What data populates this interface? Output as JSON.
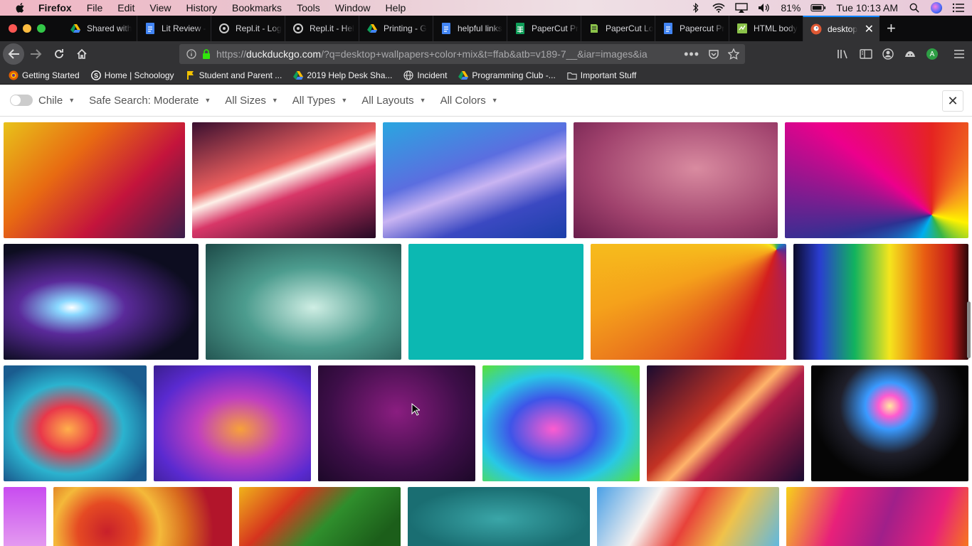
{
  "menubar": {
    "app": "Firefox",
    "items": [
      "File",
      "Edit",
      "View",
      "History",
      "Bookmarks",
      "Tools",
      "Window",
      "Help"
    ],
    "battery": "81%",
    "clock": "Tue 10:13 AM"
  },
  "tabs": [
    {
      "label": "Shared with",
      "icon": "google-drive-icon"
    },
    {
      "label": "Lit Review -",
      "icon": "google-docs-icon"
    },
    {
      "label": "Repl.it - Log",
      "icon": "replit-icon"
    },
    {
      "label": "Repl.it - Hel",
      "icon": "replit-icon"
    },
    {
      "label": "Printing - G",
      "icon": "google-drive-icon"
    },
    {
      "label": "helpful links",
      "icon": "google-docs-icon"
    },
    {
      "label": "PaperCut Pr",
      "icon": "google-sheets-icon"
    },
    {
      "label": "PaperCut Lo",
      "icon": "papercut-icon"
    },
    {
      "label": "Papercut Pr",
      "icon": "google-docs-icon"
    },
    {
      "label": "HTML body",
      "icon": "google-sheets-icon"
    },
    {
      "label": "desktop",
      "icon": "duckduckgo-icon",
      "active": true
    }
  ],
  "address": {
    "prefix": "https://",
    "host": "duckduckgo.com",
    "path": "/?q=desktop+wallpapers+color+mix&t=ffab&atb=v189-7__&iar=images&ia"
  },
  "bookmarks": [
    {
      "label": "Getting Started",
      "icon": "firefox-icon"
    },
    {
      "label": "Home | Schoology",
      "icon": "schoology-icon"
    },
    {
      "label": "Student and Parent ...",
      "icon": "bookmark-flag-icon"
    },
    {
      "label": "2019 Help Desk Sha...",
      "icon": "google-drive-icon"
    },
    {
      "label": "Incident",
      "icon": "globe-icon"
    },
    {
      "label": "Programming Club -...",
      "icon": "google-drive-icon"
    },
    {
      "label": "Important Stuff",
      "icon": "folder-icon"
    }
  ],
  "filters": {
    "region": "Chile",
    "safe_search": "Safe Search: Moderate",
    "sizes": "All Sizes",
    "types": "All Types",
    "layouts": "All Layouts",
    "colors": "All Colors"
  },
  "colors": {
    "tab_strip": "#0c0c0d",
    "toolbar": "#323234",
    "active_tab_accent": "#0a84ff",
    "results_bg": "#ffffff"
  },
  "image_results": [
    {
      "name": "image-mosaic-squares",
      "bg": "linear-gradient(135deg,#e8c21a,#e86a12 35%,#c4143c 65%,#3a1f4a)"
    },
    {
      "name": "image-light-streak-pink",
      "bg": "linear-gradient(160deg,#3a1030,#e95d5d 40%,#fdf0e8 48%,#d83768 60%,#250a24)"
    },
    {
      "name": "image-blue-waves",
      "bg": "linear-gradient(160deg,#2aa6e0,#5b6ee0 40%,#c9b4f2 55%,#3b49c2 75%,#1b3fa8)"
    },
    {
      "name": "image-mauve-gradient",
      "bg": "radial-gradient(ellipse at 60% 40%,#d98ba0,#a0426d 60%,#6a1d4b)"
    },
    {
      "name": "image-rainbow-swirl",
      "bg": "conic-gradient(from 0deg at 80% 80%,#e52421,#f7941d,#fff200,#36b449,#00aeef,#2e3192,#ec008c,#e52421)"
    },
    {
      "name": "image-light-ribbons",
      "bg": "radial-gradient(ellipse at 35% 55%,#ffffff 0%,#8ad8ff 8%,#5a2a9a 30%,#0d0d20 70%)"
    },
    {
      "name": "image-teal-blur",
      "bg": "radial-gradient(ellipse at 55% 55%,#cfeee4,#4c9c8e 45%,#1d4a48)"
    },
    {
      "name": "image-solid-teal",
      "bg": "#0cb8b2"
    },
    {
      "name": "image-rainbow-curves",
      "bg": "conic-gradient(from 200deg at 95% 5%,#d41f1f,#f5a11b,#f7e31d,#4db748,#1c78c2,#5a2c8f,#9c1f6a,#d41f1f)"
    },
    {
      "name": "image-spectrum-lines",
      "bg": "linear-gradient(90deg,#0b0b2a,#2a3dd0 15%,#11b35e 35%,#f5e51d 55%,#e85c12 75%,#c41a1a 90%,#2a0808)"
    },
    {
      "name": "image-feather-burst",
      "bg": "radial-gradient(ellipse at 45% 55%,#ffb04b,#e9384a 25%,#2bb3cf 50%,#1a5c8f 80%)"
    },
    {
      "name": "image-abstract-glass",
      "bg": "radial-gradient(ellipse at 55% 55%,#f7a13a,#c03fbf 35%,#5a2ad0 70%,#3a1f8f)"
    },
    {
      "name": "image-purple-vignette",
      "bg": "radial-gradient(ellipse at 50% 40%,#8a1d80,#3d0e48 60%,#1c0828)"
    },
    {
      "name": "image-psychedelic-swirl",
      "bg": "radial-gradient(ellipse at 45% 55%,#fd5cd0,#3e55e8 35%,#28c8e6 60%,#57e03f 90%)"
    },
    {
      "name": "image-orange-streaks",
      "bg": "linear-gradient(135deg,#1a0b30,#c33224 40%,#ffb36a 50%,#b21d48 60%,#1a0b30)"
    },
    {
      "name": "image-rainbow-heart",
      "bg": "radial-gradient(ellipse at 50% 35%,#ffe9a0 0%,#ff5bd0 10%,#3a9aff 22%,#1f1f2a 45%,#050505 70%)"
    },
    {
      "name": "image-pink-blur-partial",
      "bg": "linear-gradient(180deg,#c84cf0,#e6a0f0)"
    },
    {
      "name": "image-roses",
      "bg": "radial-gradient(circle at 30% 70%,#c8202a 0%,#e54a23 22%,#f4b93a 40%,#d86a1e 60%,#b2152b 80%)"
    },
    {
      "name": "image-paint-green",
      "bg": "linear-gradient(135deg,#f0b31a,#d6341e 30%,#2f8e2c 55%,#1c5e1a 85%)"
    },
    {
      "name": "image-teal-vignette",
      "bg": "radial-gradient(ellipse at 50% 50%,#3aa6a8,#1a6e72 70%)"
    },
    {
      "name": "image-paint-splash",
      "bg": "linear-gradient(120deg,#4aa0e6,#f7f2f0 30%,#e8423a 50%,#f0c24a 70%,#5ab8e6)"
    },
    {
      "name": "image-magenta-ribbons",
      "bg": "linear-gradient(110deg,#f7d21a,#e8207a 30%,#a01f8a 55%,#e8207a 80%,#f77a1a)"
    }
  ]
}
